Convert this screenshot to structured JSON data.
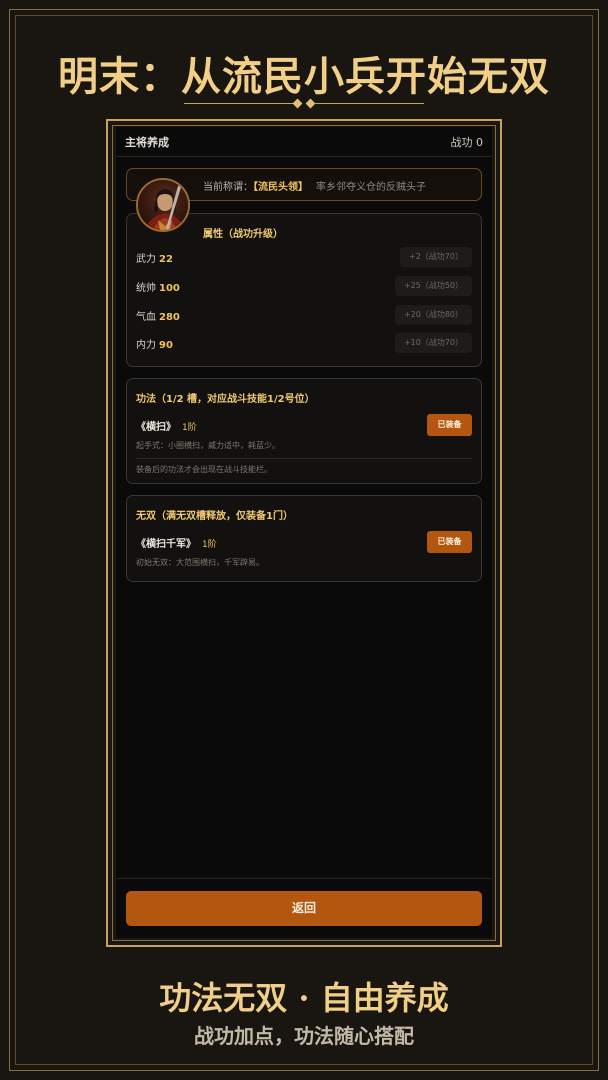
{
  "promo": {
    "title": "明末：从流民小兵开始无双",
    "slogan": "功法无双 · 自由养成",
    "subslogan": "战功加点，功法随心搭配"
  },
  "topbar": {
    "title": "主将养成",
    "merit": "战功 0"
  },
  "status": {
    "label": "当前称谓：",
    "rank": "【流民头领】",
    "desc": "率乡邻夺义仓的反贼头子"
  },
  "attributes": {
    "title": "属性（战功升级）",
    "items": [
      {
        "name": "武力",
        "value": "22",
        "upgrade": "+2（战功70）"
      },
      {
        "name": "统帅",
        "value": "100",
        "upgrade": "+25（战功50）"
      },
      {
        "name": "气血",
        "value": "280",
        "upgrade": "+20（战功80）"
      },
      {
        "name": "内力",
        "value": "90",
        "upgrade": "+10（战功70）"
      }
    ]
  },
  "gongfa": {
    "title": "功法（1/2 槽，对应战斗技能1/2号位）",
    "skill": {
      "name": "《横扫》",
      "level": "1阶",
      "desc": "起手式：小圈横扫，威力适中，耗蓝少。",
      "button": "已装备"
    },
    "note": "装备后的功法才会出现在战斗技能栏。"
  },
  "wushuang": {
    "title": "无双（满无双槽释放，仅装备1门）",
    "skill": {
      "name": "《横扫千军》",
      "level": "1阶",
      "desc": "初始无双：大范围横扫，千军辟易。",
      "button": "已装备"
    }
  },
  "back_button": "返回",
  "colors": {
    "accent": "#f1cf87",
    "button": "#b3560f",
    "highlight": "#f0c35d",
    "background": "#0b0a0a"
  }
}
